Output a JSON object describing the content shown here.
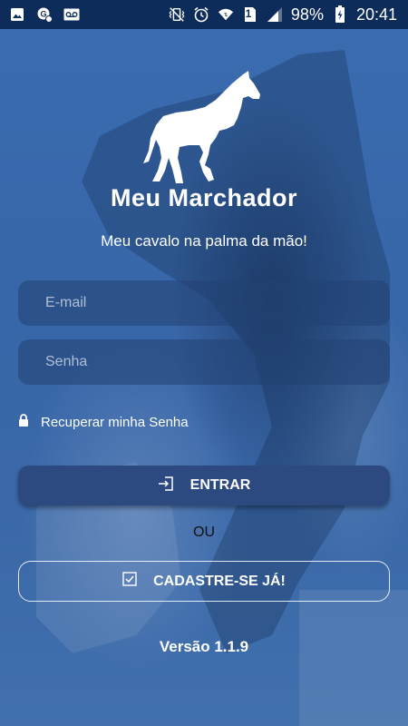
{
  "status_bar": {
    "left_icons": [
      "image-icon",
      "google-maps-icon",
      "voicemail-icon"
    ],
    "right_icons": [
      "vibrate-mute-icon",
      "alarm-icon",
      "wifi-icon",
      "sim1-icon",
      "signal-icon",
      "battery-charging-icon"
    ],
    "sim_label": "1",
    "battery": "98%",
    "time": "20:41"
  },
  "brand": {
    "logo_icon": "horse-icon",
    "name": "Meu Marchador",
    "tagline": "Meu cavalo na palma da mão!"
  },
  "form": {
    "email_placeholder": "E-mail",
    "password_placeholder": "Senha",
    "recover_icon": "lock-icon",
    "recover_label": "Recuperar minha Senha"
  },
  "actions": {
    "login_icon": "login-icon",
    "login_label": "ENTRAR",
    "or_label": "OU",
    "signup_icon": "checkbox-icon",
    "signup_label": "CADASTRE-SE JÁ!"
  },
  "footer": {
    "version": "Versão 1.1.9"
  },
  "colors": {
    "background": "#3566a8",
    "status_bar": "#0d2c5a",
    "field_bg": "#28487d",
    "login_button": "#2d4a80",
    "text": "#ffffff"
  }
}
